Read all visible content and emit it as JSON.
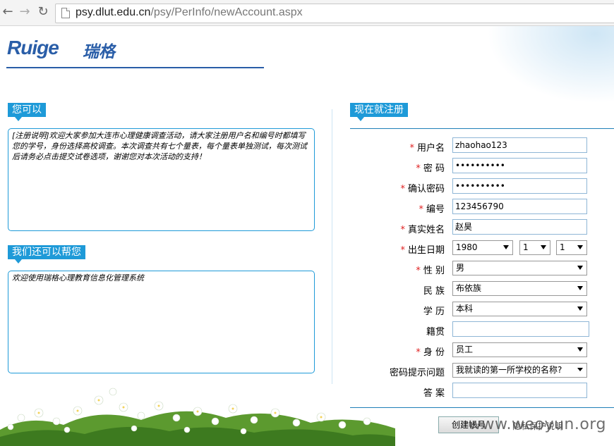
{
  "browser": {
    "url_host": "psy.dlut.edu.cn",
    "url_path": "/psy/PerInfo/newAccount.aspx"
  },
  "header": {
    "logo_text": "Ruige",
    "logo_cn": "瑞格"
  },
  "left": {
    "section1_title": "您可以",
    "section1_text": "[注册说明]欢迎大家参加大连市心理健康调查活动，请大家注册用户名和编号时都填写您的学号，身份选择高校调查。本次调查共有七个量表，每个量表单独测试，每次测试后请务必点击提交试卷选项，谢谢您对本次活动的支持！",
    "section2_title": "我们还可以帮您",
    "section2_text": "欢迎使用瑞格心理教育信息化管理系统"
  },
  "form": {
    "title": "现在就注册",
    "required_mark": "*",
    "username_label": "用户名",
    "username_value": "zhaohao123",
    "password_label": "密 码",
    "password_value": "••••••••••",
    "confirm_label": "确认密码",
    "confirm_value": "••••••••••",
    "number_label": "编号",
    "number_value": "123456790",
    "realname_label": "真实姓名",
    "realname_value": "赵昊",
    "birth_label": "出生日期",
    "birth_year": "1980",
    "birth_month": "1",
    "birth_day": "1",
    "gender_label": "性 别",
    "gender_value": "男",
    "ethnic_label": "民 族",
    "ethnic_value": "布依族",
    "education_label": "学 历",
    "education_value": "本科",
    "native_label": "籍贯",
    "native_value": "",
    "identity_label": "身 份",
    "identity_value": "员工",
    "question_label": "密码提示问题",
    "question_value": "我就读的第一所学校的名称?",
    "answer_label": "答 案",
    "answer_value": "",
    "create_button": "创建帐号",
    "privacy_link": "隐私保护说明"
  },
  "watermark": "www.weoyun.org",
  "colors": {
    "accent": "#1e9ad8",
    "logo": "#2a5ea8",
    "required": "#e02020"
  }
}
